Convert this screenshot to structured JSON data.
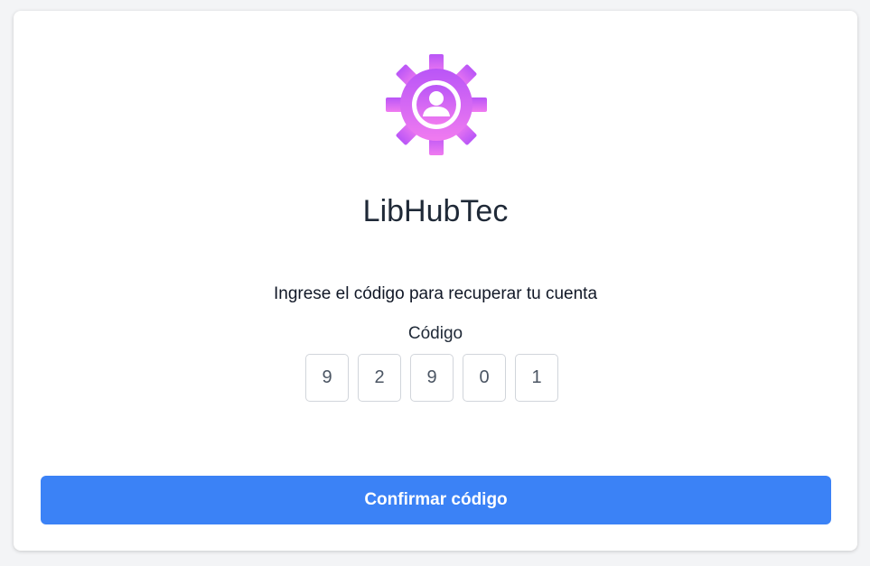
{
  "app": {
    "name": "LibHubTec",
    "logo_icon": "gear-user-icon",
    "logo_gradient": [
      "#b955f7",
      "#f07bf0"
    ]
  },
  "form": {
    "instruction": "Ingrese el código para recuperar tu cuenta",
    "code_label": "Código",
    "digits": [
      "9",
      "2",
      "9",
      "0",
      "1"
    ],
    "submit_label": "Confirmar código"
  },
  "colors": {
    "primary": "#3b82f6",
    "background": "#ffffff"
  }
}
